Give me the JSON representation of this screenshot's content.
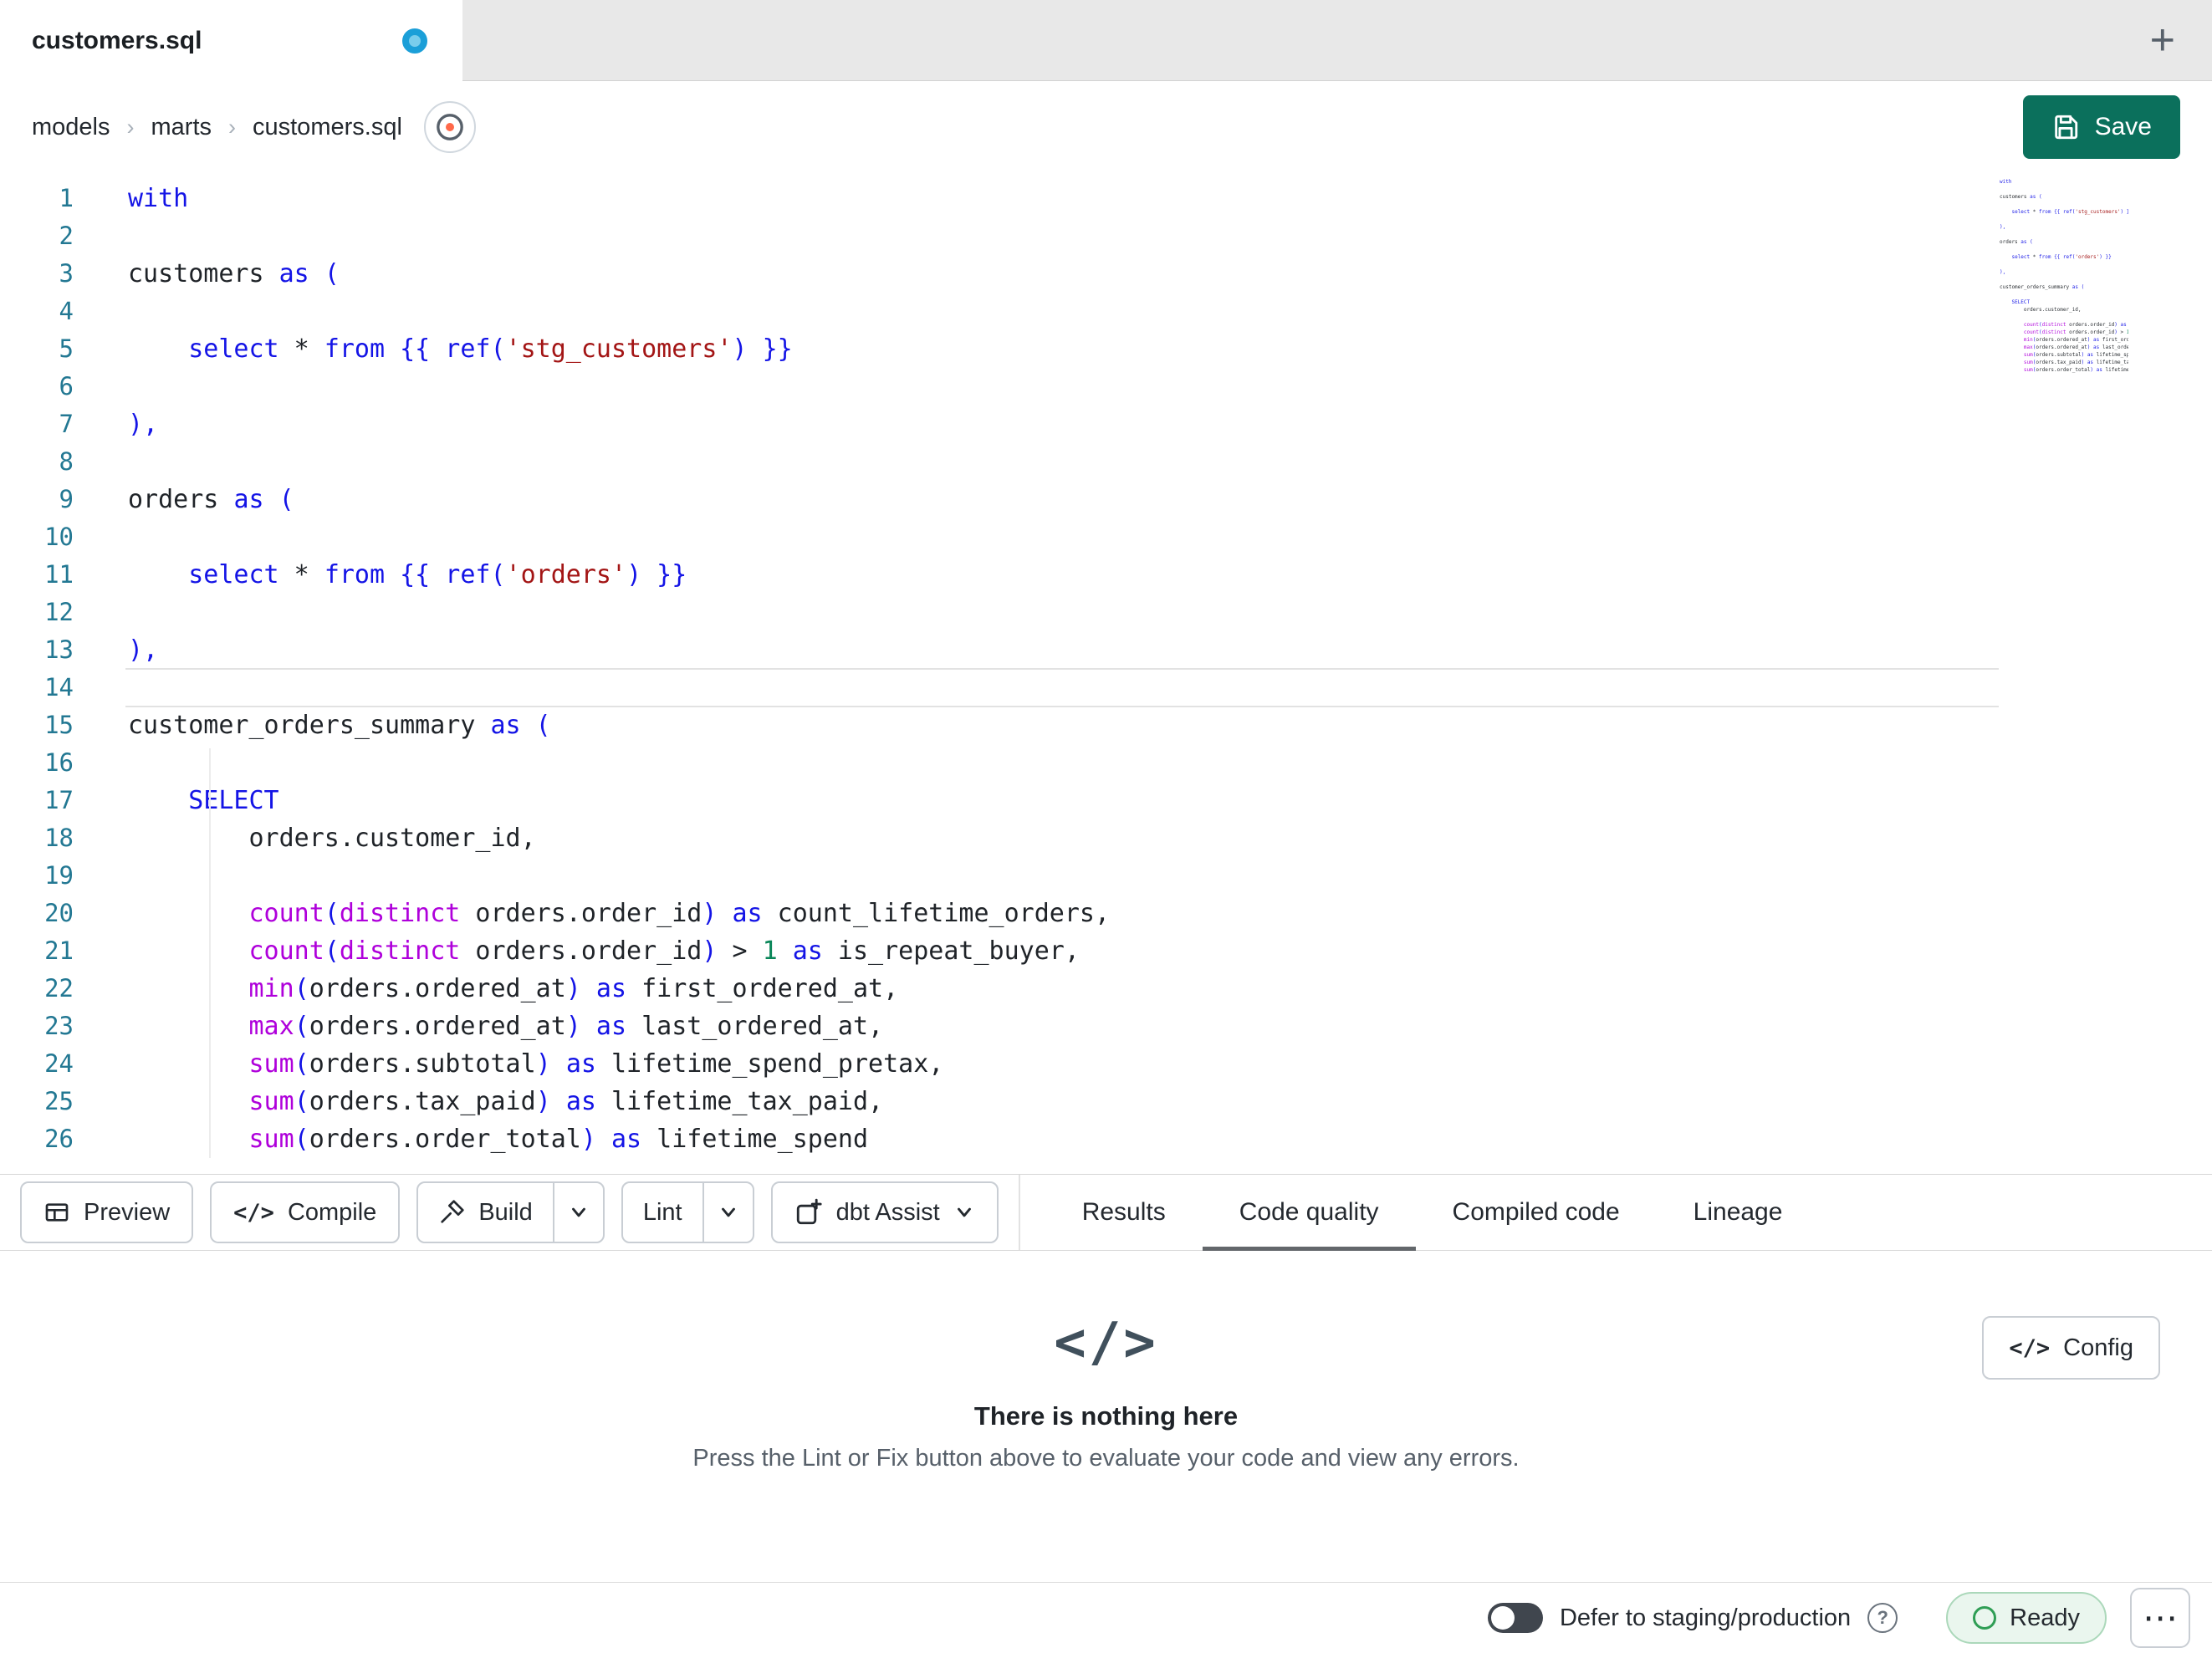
{
  "window": {
    "new_tab_label": "+"
  },
  "tab": {
    "title": "customers.sql",
    "unsaved": true
  },
  "breadcrumb": {
    "items": [
      "models",
      "marts",
      "customers.sql"
    ],
    "separator": "›"
  },
  "save_button": {
    "label": "Save"
  },
  "editor": {
    "current_line": 14,
    "lines": [
      {
        "n": 1,
        "segs": [
          [
            "k",
            "with"
          ]
        ]
      },
      {
        "n": 2,
        "segs": []
      },
      {
        "n": 3,
        "segs": [
          [
            "p",
            "customers "
          ],
          [
            "k",
            "as"
          ],
          [
            "p",
            " "
          ],
          [
            "k",
            "("
          ]
        ]
      },
      {
        "n": 4,
        "segs": []
      },
      {
        "n": 5,
        "segs": [
          [
            "p",
            "    "
          ],
          [
            "k",
            "select"
          ],
          [
            "p",
            " * "
          ],
          [
            "k",
            "from"
          ],
          [
            "p",
            " "
          ],
          [
            "k",
            "{{ ref("
          ],
          [
            "s",
            "'stg_customers'"
          ],
          [
            "k",
            ") }}"
          ]
        ]
      },
      {
        "n": 6,
        "segs": []
      },
      {
        "n": 7,
        "segs": [
          [
            "k",
            "),"
          ]
        ]
      },
      {
        "n": 8,
        "segs": []
      },
      {
        "n": 9,
        "segs": [
          [
            "p",
            "orders "
          ],
          [
            "k",
            "as"
          ],
          [
            "p",
            " "
          ],
          [
            "k",
            "("
          ]
        ]
      },
      {
        "n": 10,
        "segs": []
      },
      {
        "n": 11,
        "segs": [
          [
            "p",
            "    "
          ],
          [
            "k",
            "select"
          ],
          [
            "p",
            " * "
          ],
          [
            "k",
            "from"
          ],
          [
            "p",
            " "
          ],
          [
            "k",
            "{{ ref("
          ],
          [
            "s",
            "'orders'"
          ],
          [
            "k",
            ") }}"
          ]
        ]
      },
      {
        "n": 12,
        "segs": []
      },
      {
        "n": 13,
        "segs": [
          [
            "k",
            "),"
          ]
        ]
      },
      {
        "n": 14,
        "segs": [],
        "current": true
      },
      {
        "n": 15,
        "segs": [
          [
            "p",
            "customer_orders_summary "
          ],
          [
            "k",
            "as"
          ],
          [
            "p",
            " "
          ],
          [
            "k",
            "("
          ]
        ]
      },
      {
        "n": 16,
        "segs": []
      },
      {
        "n": 17,
        "segs": [
          [
            "p",
            "    "
          ],
          [
            "k",
            "SELECT"
          ]
        ]
      },
      {
        "n": 18,
        "segs": [
          [
            "p",
            "        orders.customer_id,"
          ]
        ]
      },
      {
        "n": 19,
        "segs": []
      },
      {
        "n": 20,
        "segs": [
          [
            "p",
            "        "
          ],
          [
            "f",
            "count"
          ],
          [
            "k",
            "("
          ],
          [
            "f",
            "distinct"
          ],
          [
            "p",
            " orders.order_id"
          ],
          [
            "k",
            ")"
          ],
          [
            "p",
            " "
          ],
          [
            "k",
            "as"
          ],
          [
            "p",
            " count_lifetime_orders,"
          ]
        ]
      },
      {
        "n": 21,
        "segs": [
          [
            "p",
            "        "
          ],
          [
            "f",
            "count"
          ],
          [
            "k",
            "("
          ],
          [
            "f",
            "distinct"
          ],
          [
            "p",
            " orders.order_id"
          ],
          [
            "k",
            ")"
          ],
          [
            "p",
            " > "
          ],
          [
            "num",
            "1"
          ],
          [
            "p",
            " "
          ],
          [
            "k",
            "as"
          ],
          [
            "p",
            " is_repeat_buyer,"
          ]
        ]
      },
      {
        "n": 22,
        "segs": [
          [
            "p",
            "        "
          ],
          [
            "f",
            "min"
          ],
          [
            "k",
            "("
          ],
          [
            "p",
            "orders.ordered_at"
          ],
          [
            "k",
            ")"
          ],
          [
            "p",
            " "
          ],
          [
            "k",
            "as"
          ],
          [
            "p",
            " first_ordered_at,"
          ]
        ]
      },
      {
        "n": 23,
        "segs": [
          [
            "p",
            "        "
          ],
          [
            "f",
            "max"
          ],
          [
            "k",
            "("
          ],
          [
            "p",
            "orders.ordered_at"
          ],
          [
            "k",
            ")"
          ],
          [
            "p",
            " "
          ],
          [
            "k",
            "as"
          ],
          [
            "p",
            " last_ordered_at,"
          ]
        ]
      },
      {
        "n": 24,
        "segs": [
          [
            "p",
            "        "
          ],
          [
            "f",
            "sum"
          ],
          [
            "k",
            "("
          ],
          [
            "p",
            "orders.subtotal"
          ],
          [
            "k",
            ")"
          ],
          [
            "p",
            " "
          ],
          [
            "k",
            "as"
          ],
          [
            "p",
            " lifetime_spend_pretax,"
          ]
        ]
      },
      {
        "n": 25,
        "segs": [
          [
            "p",
            "        "
          ],
          [
            "f",
            "sum"
          ],
          [
            "k",
            "("
          ],
          [
            "p",
            "orders.tax_paid"
          ],
          [
            "k",
            ")"
          ],
          [
            "p",
            " "
          ],
          [
            "k",
            "as"
          ],
          [
            "p",
            " lifetime_tax_paid,"
          ]
        ]
      },
      {
        "n": 26,
        "segs": [
          [
            "p",
            "        "
          ],
          [
            "f",
            "sum"
          ],
          [
            "k",
            "("
          ],
          [
            "p",
            "orders.order_total"
          ],
          [
            "k",
            ")"
          ],
          [
            "p",
            " "
          ],
          [
            "k",
            "as"
          ],
          [
            "p",
            " lifetime_spend"
          ]
        ]
      }
    ]
  },
  "toolbar": {
    "preview": "Preview",
    "compile": "Compile",
    "build": "Build",
    "lint": "Lint",
    "dbt_assist": "dbt Assist"
  },
  "result_tabs": [
    {
      "label": "Results",
      "active": false
    },
    {
      "label": "Code quality",
      "active": true
    },
    {
      "label": "Compiled code",
      "active": false
    },
    {
      "label": "Lineage",
      "active": false
    }
  ],
  "empty_state": {
    "title": "There is nothing here",
    "subtitle": "Press the Lint or Fix button above to evaluate your code and view any errors.",
    "config_label": "Config"
  },
  "statusbar": {
    "defer_label": "Defer to staging/production",
    "ready_label": "Ready"
  },
  "icons": {
    "code_glyph": "</>",
    "question": "?",
    "dots": "⋯"
  },
  "colors": {
    "accent_save": "#0b705c",
    "keyword": "#1414e6",
    "function": "#af00db",
    "string": "#a31515",
    "number": "#098658",
    "line_number": "#237893",
    "ready_green": "#2f9e55",
    "unsaved_dot": "#1b9fd8"
  }
}
